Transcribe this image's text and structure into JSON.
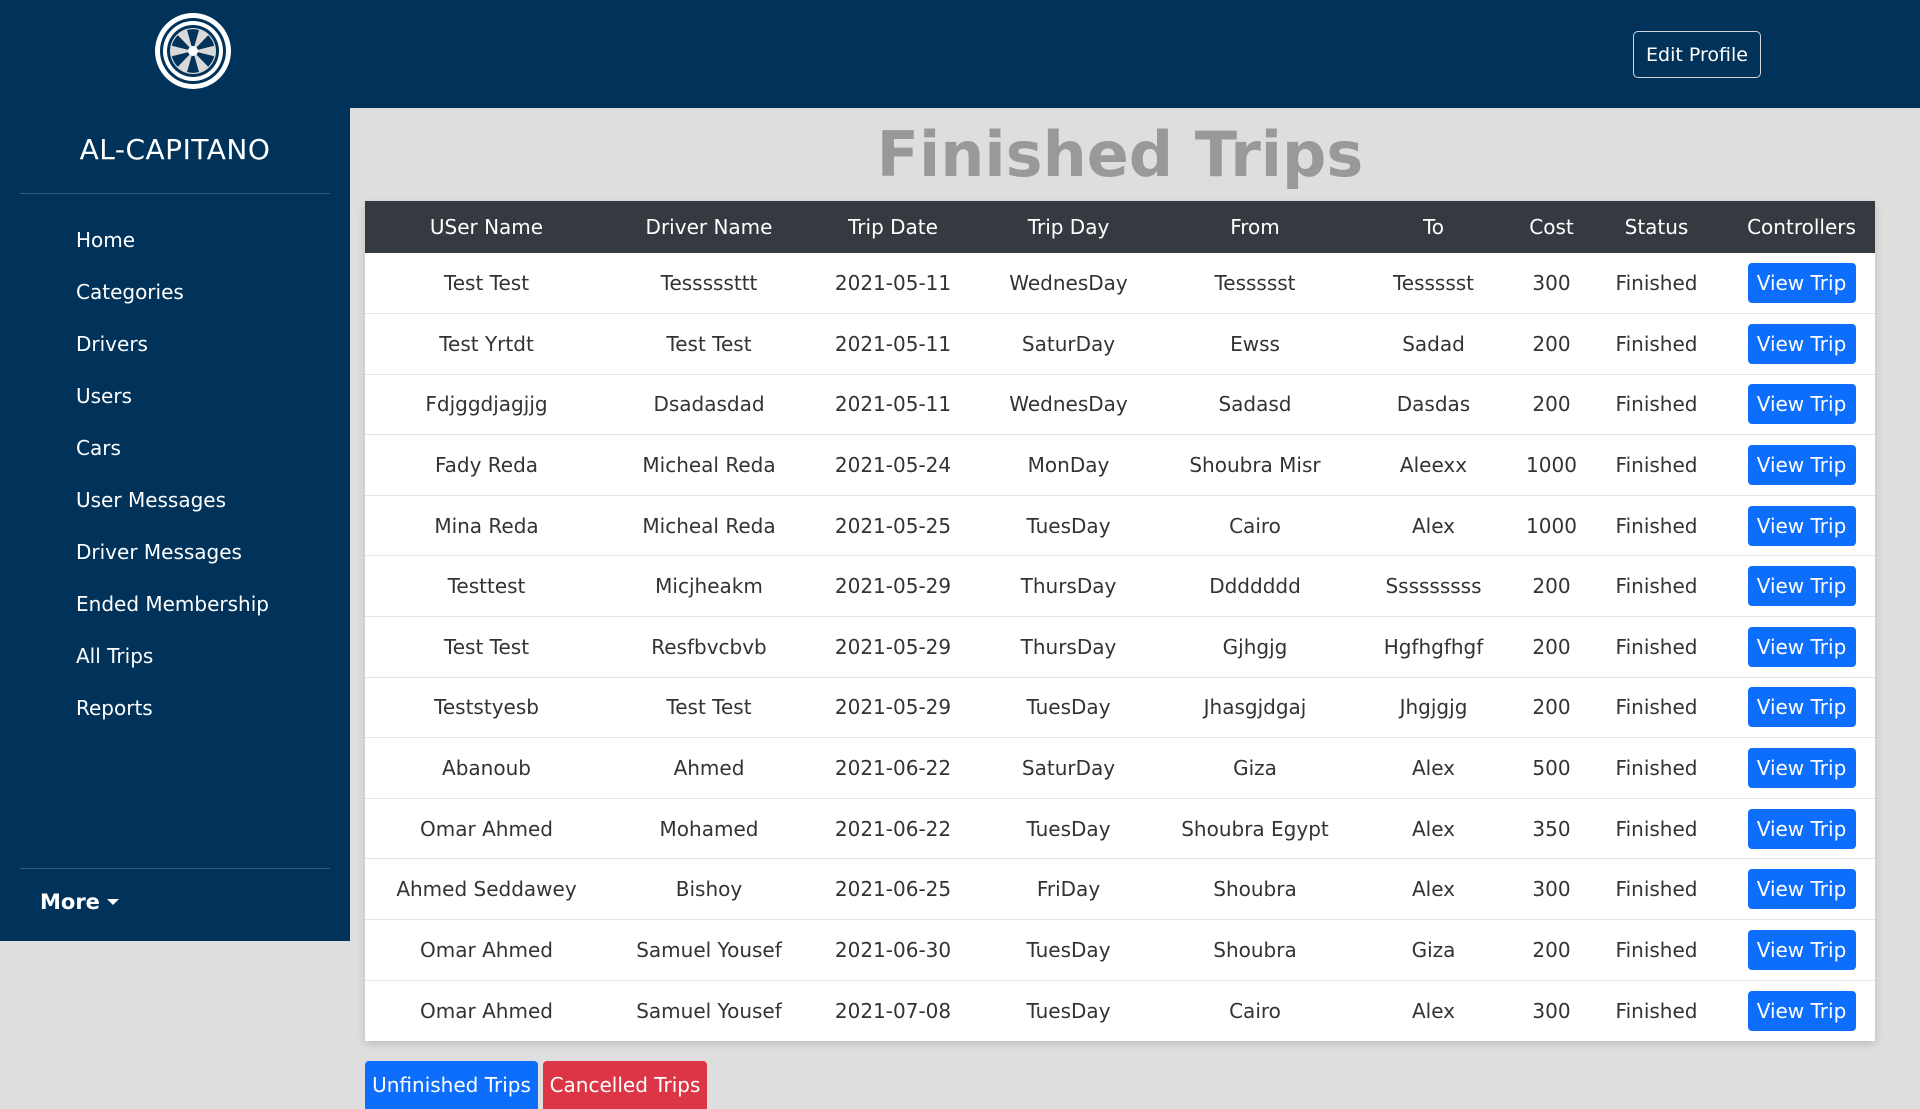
{
  "header": {
    "edit_profile_label": "Edit Profile"
  },
  "sidebar": {
    "brand": "AL-CAPITANO",
    "items": [
      {
        "label": "Home"
      },
      {
        "label": "Categories"
      },
      {
        "label": "Drivers"
      },
      {
        "label": "Users"
      },
      {
        "label": "Cars"
      },
      {
        "label": "User Messages"
      },
      {
        "label": "Driver Messages"
      },
      {
        "label": "Ended Membership"
      },
      {
        "label": "All Trips"
      },
      {
        "label": "Reports"
      }
    ],
    "more_label": "More"
  },
  "main": {
    "title": "Finished Trips",
    "table": {
      "headers": [
        "USer Name",
        "Driver Name",
        "Trip Date",
        "Trip Day",
        "From",
        "To",
        "Cost",
        "Status",
        "Controllers"
      ],
      "action_label": "View Trip",
      "rows": [
        [
          "Test Test",
          "Tesssssttt",
          "2021-05-11",
          "WednesDay",
          "Tessssst",
          "Tessssst",
          "300",
          "Finished"
        ],
        [
          "Test Yrtdt",
          "Test Test",
          "2021-05-11",
          "SaturDay",
          "Ewss",
          "Sadad",
          "200",
          "Finished"
        ],
        [
          "Fdjggdjagjjg",
          "Dsadasdad",
          "2021-05-11",
          "WednesDay",
          "Sadasd",
          "Dasdas",
          "200",
          "Finished"
        ],
        [
          "Fady Reda",
          "Micheal Reda",
          "2021-05-24",
          "MonDay",
          "Shoubra Misr",
          "Aleexx",
          "1000",
          "Finished"
        ],
        [
          "Mina Reda",
          "Micheal Reda",
          "2021-05-25",
          "TuesDay",
          "Cairo",
          "Alex",
          "1000",
          "Finished"
        ],
        [
          "Testtest",
          "Micjheakm",
          "2021-05-29",
          "ThursDay",
          "Ddddddd",
          "Sssssssss",
          "200",
          "Finished"
        ],
        [
          "Test Test",
          "Resfbvcbvb",
          "2021-05-29",
          "ThursDay",
          "Gjhgjg",
          "Hgfhgfhgf",
          "200",
          "Finished"
        ],
        [
          "Teststyesb",
          "Test Test",
          "2021-05-29",
          "TuesDay",
          "Jhasgjdgaj",
          "Jhgjgjg",
          "200",
          "Finished"
        ],
        [
          "Abanoub",
          "Ahmed",
          "2021-06-22",
          "SaturDay",
          "Giza",
          "Alex",
          "500",
          "Finished"
        ],
        [
          "Omar Ahmed",
          "Mohamed",
          "2021-06-22",
          "TuesDay",
          "Shoubra Egypt",
          "Alex",
          "350",
          "Finished"
        ],
        [
          "Ahmed Seddawey",
          "Bishoy",
          "2021-06-25",
          "FriDay",
          "Shoubra",
          "Alex",
          "300",
          "Finished"
        ],
        [
          "Omar Ahmed",
          "Samuel Yousef",
          "2021-06-30",
          "TuesDay",
          "Shoubra",
          "Giza",
          "200",
          "Finished"
        ],
        [
          "Omar Ahmed",
          "Samuel Yousef",
          "2021-07-08",
          "TuesDay",
          "Cairo",
          "Alex",
          "300",
          "Finished"
        ]
      ]
    },
    "buttons": {
      "unfinished_label": "Unfinished Trips",
      "cancelled_label": "Cancelled Trips"
    }
  },
  "colors": {
    "navy": "#01335a",
    "table_header": "#343a40",
    "primary": "#0d6efd",
    "danger": "#dc3545",
    "page_bg": "#dedede",
    "title_gray": "#999999"
  },
  "icons": {
    "logo": "wheel-logo-icon",
    "more_caret": "caret-down-icon"
  }
}
